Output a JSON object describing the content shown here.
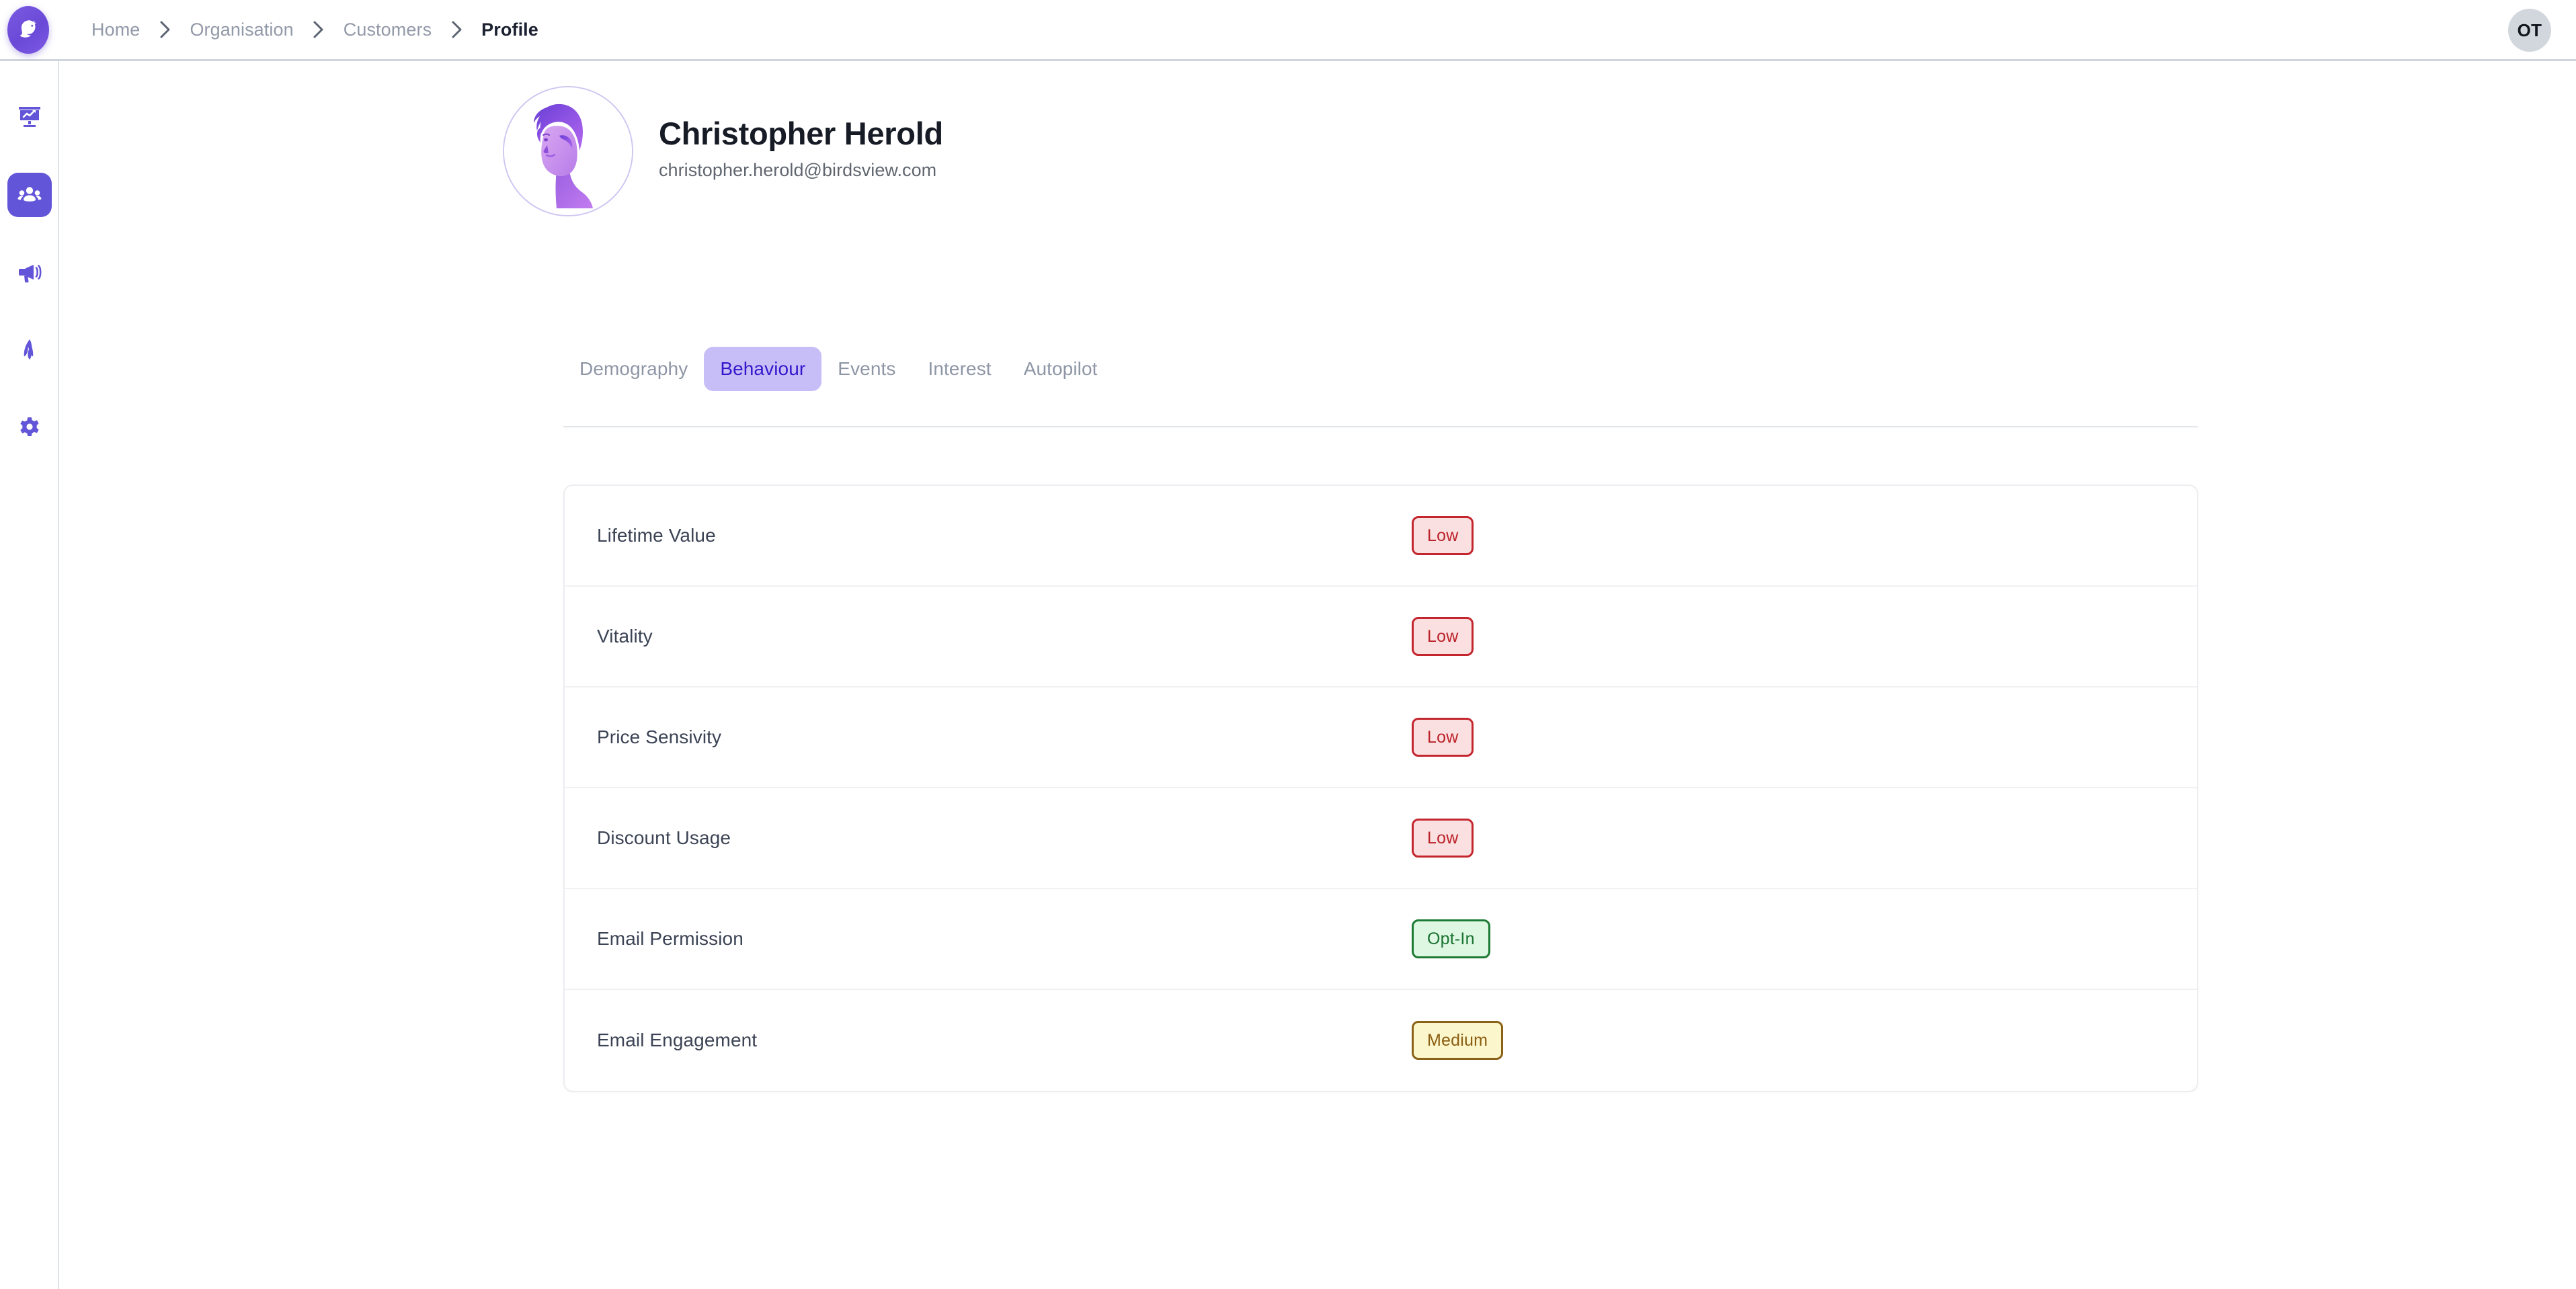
{
  "topbar": {
    "logo_icon": "bird-logo-icon",
    "breadcrumb": [
      {
        "label": "Home",
        "current": false
      },
      {
        "label": "Organisation",
        "current": false
      },
      {
        "label": "Customers",
        "current": false
      },
      {
        "label": "Profile",
        "current": true
      }
    ],
    "separator_icon": "chevron-right-icon",
    "user_initials": "OT"
  },
  "sidebar": {
    "items": [
      {
        "icon": "analytics-board-icon",
        "name": "analytics",
        "active": false
      },
      {
        "icon": "users-group-icon",
        "name": "customers",
        "active": true
      },
      {
        "icon": "megaphone-icon",
        "name": "campaigns",
        "active": false
      },
      {
        "icon": "rocket-icon",
        "name": "automation",
        "active": false
      },
      {
        "icon": "gear-icon",
        "name": "settings",
        "active": false
      }
    ]
  },
  "profile": {
    "avatar_icon": "user-portrait-illustration",
    "name": "Christopher Herold",
    "email": "christopher.herold@birdsview.com"
  },
  "tabs": [
    {
      "label": "Demography",
      "active": false
    },
    {
      "label": "Behaviour",
      "active": true
    },
    {
      "label": "Events",
      "active": false
    },
    {
      "label": "Interest",
      "active": false
    },
    {
      "label": "Autopilot",
      "active": false
    }
  ],
  "attributes": [
    {
      "label": "Lifetime Value",
      "value": "Low",
      "tone": "low"
    },
    {
      "label": "Vitality",
      "value": "Low",
      "tone": "low"
    },
    {
      "label": "Price Sensivity",
      "value": "Low",
      "tone": "low"
    },
    {
      "label": "Discount Usage",
      "value": "Low",
      "tone": "low"
    },
    {
      "label": "Email Permission",
      "value": "Opt-In",
      "tone": "green"
    },
    {
      "label": "Email Engagement",
      "value": "Medium",
      "tone": "amber"
    }
  ],
  "colors": {
    "brand_purple": "#6355d8",
    "active_tab_bg": "#c7bef8",
    "active_tab_text": "#3317cc",
    "badge_red": "#c4262e",
    "badge_green": "#1d7a34",
    "badge_amber": "#8a6116"
  }
}
